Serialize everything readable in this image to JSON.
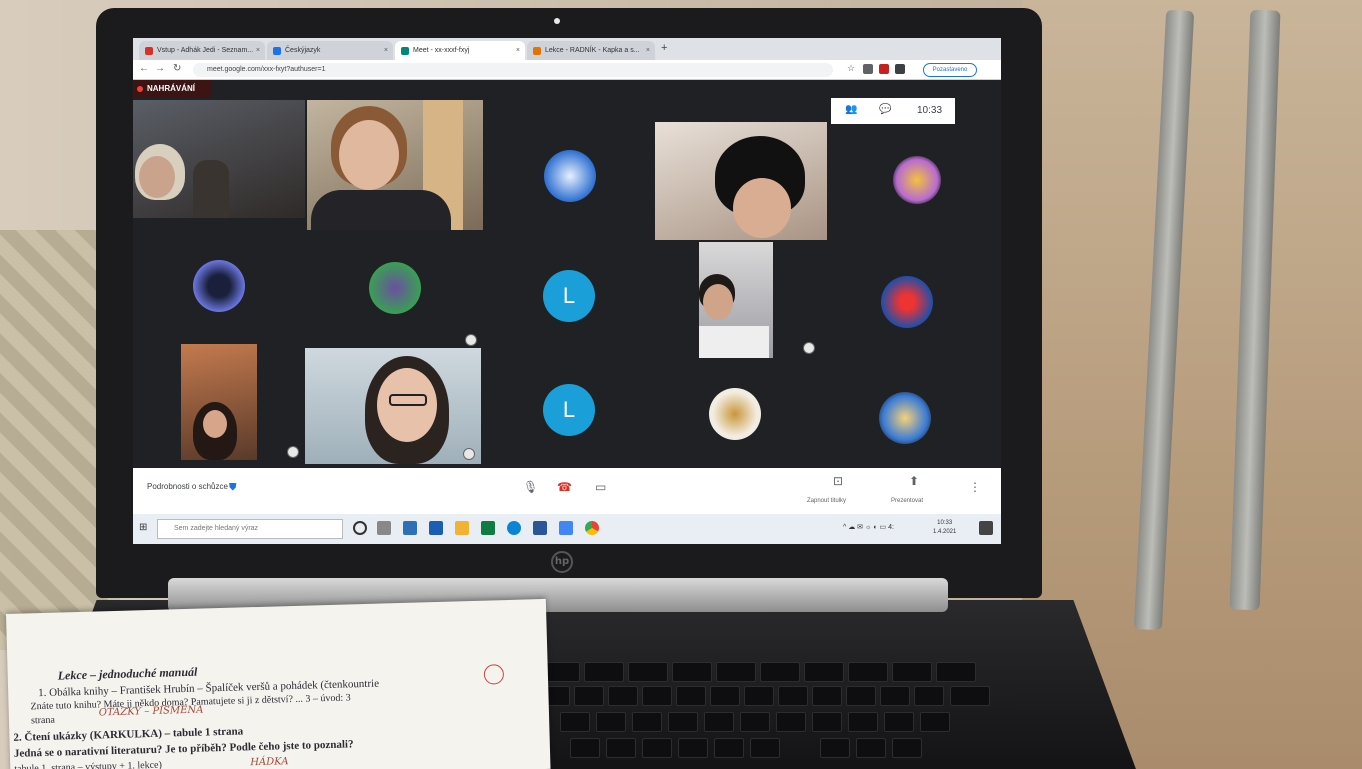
{
  "browser": {
    "tabs": [
      {
        "label": "Vstup - Adhák Jedi - Seznam...",
        "color": "#d93025",
        "active": false
      },
      {
        "label": "Českýjazyk",
        "color": "#1a73e8",
        "active": false
      },
      {
        "label": "Meet - xx-xxxf-fxyj",
        "color": "#00897b",
        "active": true
      },
      {
        "label": "Lekce - RADNÍK - Kapka a s...",
        "color": "#e37400",
        "active": false
      }
    ],
    "new_tab": "+",
    "url": "meet.google.com/xxx-fxyt?authuser=1",
    "profile_label": "Pozastaveno"
  },
  "meet": {
    "recording_label": "NAHRÁVÁNÍ",
    "clock": "10:33",
    "avatar_letter_1": "L",
    "avatar_letter_2": "L",
    "meeting_name": "Podrobnosti o schůzce",
    "caption_label": "Zapnout titulky",
    "present_label": "Prezentovat"
  },
  "taskbar": {
    "start_icon": "windows-logo",
    "search_placeholder": "Sem zadejte hledaný výraz",
    "tray_text": "^ ☁ ✉ ☼ ◐ ▭ 4:",
    "tray_time": "10:33",
    "tray_date": "1.4.2021"
  },
  "worksheet": {
    "heading": "Lekce – jednoduché manuál",
    "line1": "1. Obálka knihy – František Hrubín – Špalíček veršů a pohádek (čtenkountrie",
    "line2": "Znáte tuto knihu? Máte ji někdo doma? Pamatujete si ji z dětství? ... 3 – úvod: 3",
    "line3": "strana",
    "line4": "2. Čtení ukázky (KARKULKA) – tabule 1 strana",
    "line5": "Jedná se o narativní literaturu? Je to příběh? Podle čeho jste to poznali?",
    "line6": "tabule 1. strana – výstupy + 1. lekce)",
    "hand1": "OTÁZKY – PÍSMENA",
    "hand2": "HÁDKA"
  },
  "icons": {
    "back": "←",
    "forward": "→",
    "reload": "↻",
    "star": "☆",
    "mic": "🎙",
    "hangup": "☎",
    "camera": "▭",
    "caption": "⊡",
    "present": "⬆",
    "more": "⋮",
    "people": "👥",
    "chat": "💬",
    "pin": "📌"
  }
}
